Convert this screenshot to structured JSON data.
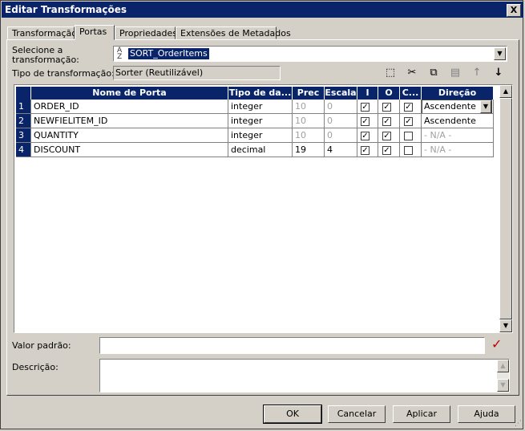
{
  "window": {
    "title": "Editar Transformações",
    "close_label": "X"
  },
  "tabs": [
    {
      "label": "Transformação",
      "active": false
    },
    {
      "label": "Portas",
      "active": true
    },
    {
      "label": "Propriedades",
      "active": false
    },
    {
      "label": "Extensões de Metadados",
      "active": false
    }
  ],
  "form": {
    "select_label_line1": "Selecione a",
    "select_label_line2": "transformação:",
    "selected_transformation": "SORT_OrderItems",
    "type_label": "Tipo de transformação:",
    "type_value": "Sorter (Reutilizável)",
    "default_label": "Valor padrão:",
    "default_value": "",
    "description_label": "Descrição:",
    "description_value": ""
  },
  "toolbar": {
    "new_icon": "new-port-icon",
    "cut_icon": "cut-icon",
    "copy_icon": "copy-icon",
    "paste_icon": "paste-icon",
    "up_icon": "move-up-icon",
    "down_icon": "move-down-icon"
  },
  "grid": {
    "columns": [
      "Nome de Porta",
      "Tipo de da...",
      "Prec",
      "Escala",
      "I",
      "O",
      "C...",
      "Direção"
    ],
    "rows": [
      {
        "num": "1",
        "name": "ORDER_ID",
        "type": "integer",
        "prec": "10",
        "scale": "0",
        "i": true,
        "o": true,
        "c": true,
        "dir": "Ascendente"
      },
      {
        "num": "2",
        "name": "NEWFIELITEM_ID",
        "type": "integer",
        "prec": "10",
        "scale": "0",
        "i": true,
        "o": true,
        "c": true,
        "dir": "Ascendente"
      },
      {
        "num": "3",
        "name": "QUANTITY",
        "type": "integer",
        "prec": "10",
        "scale": "0",
        "i": true,
        "o": true,
        "c": false,
        "dir": "- N/A -"
      },
      {
        "num": "4",
        "name": "DISCOUNT",
        "type": "decimal",
        "prec": "19",
        "scale": "4",
        "i": true,
        "o": true,
        "c": false,
        "dir": "- N/A -"
      }
    ]
  },
  "buttons": {
    "ok": "OK",
    "cancel": "Cancelar",
    "apply": "Aplicar",
    "help": "Ajuda"
  },
  "colors": {
    "title_bar": "#0a246a",
    "validate_check": "#c00000"
  }
}
